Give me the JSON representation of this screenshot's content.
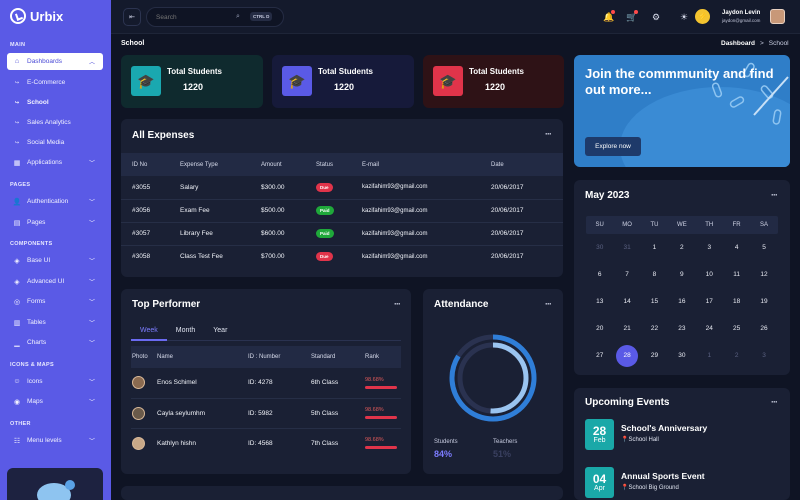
{
  "brand": "Urbix",
  "sidebar": {
    "sections": {
      "main": "MAIN",
      "pages": "PAGES",
      "components": "COMPONENTS",
      "icons": "ICONS & MAPS",
      "other": "OTHER"
    },
    "items": {
      "dashboards": "Dashboards",
      "ecommerce": "E-Commerce",
      "school": "School",
      "sales": "Sales Analytics",
      "social": "Social Media",
      "applications": "Applications",
      "authentication": "Authentication",
      "pages": "Pages",
      "base_ui": "Base UI",
      "advanced_ui": "Advanced UI",
      "forms": "Forms",
      "tables": "Tables",
      "charts": "Charts",
      "icons": "Icons",
      "maps": "Maps",
      "menu_levels": "Menu levels"
    }
  },
  "topbar": {
    "search_placeholder": "Search",
    "shortcut": "CTRL D",
    "user_name": "Jaydon Levin",
    "user_email": "jaydon@gmail.com"
  },
  "breadcrumb": {
    "title": "School",
    "home": "Dashboard",
    "separator": ">",
    "current": "School"
  },
  "stats": [
    {
      "label": "Total Students",
      "value": "1220",
      "color": "#1aa8b0",
      "bg": "#0f2a2e"
    },
    {
      "label": "Total Students",
      "value": "1220",
      "color": "#5a5ae6",
      "bg": "#161a3a"
    },
    {
      "label": "Total Students",
      "value": "1220",
      "color": "#e0344a",
      "bg": "#2e1216"
    }
  ],
  "expenses": {
    "title": "All Expenses",
    "headers": [
      "ID No",
      "Expense Type",
      "Amount",
      "Status",
      "E-mail",
      "Date"
    ],
    "rows": [
      {
        "id": "#3055",
        "type": "Salary",
        "amount": "$300.00",
        "status": "Due",
        "email": "kazifahim93@gmail.com",
        "date": "20/06/2017"
      },
      {
        "id": "#3056",
        "type": "Exam Fee",
        "amount": "$500.00",
        "status": "Paid",
        "email": "kazifahim93@gmail.com",
        "date": "20/06/2017"
      },
      {
        "id": "#3057",
        "type": "Library Fee",
        "amount": "$600.00",
        "status": "Paid",
        "email": "kazifahim93@gmail.com",
        "date": "20/06/2017"
      },
      {
        "id": "#3058",
        "type": "Class Test Fee",
        "amount": "$700.00",
        "status": "Due",
        "email": "kazifahim93@gmail.com",
        "date": "20/06/2017"
      }
    ]
  },
  "performer": {
    "title": "Top Performer",
    "tabs": [
      "Week",
      "Month",
      "Year"
    ],
    "headers": [
      "Photo",
      "Name",
      "ID : Number",
      "Standard",
      "Rank"
    ],
    "rows": [
      {
        "name": "Enos Schimel",
        "id": "ID: 4278",
        "standard": "6th Class",
        "rank": "98.68%"
      },
      {
        "name": "Cayla seylumhm",
        "id": "ID: 5982",
        "standard": "5th Class",
        "rank": "98.68%"
      },
      {
        "name": "Kathlyn hishn",
        "id": "ID: 4568",
        "standard": "7th Class",
        "rank": "98.68%"
      }
    ]
  },
  "attendance": {
    "title": "Attendance",
    "students_label": "Students",
    "students_value": "84%",
    "teachers_label": "Teachers",
    "teachers_value": "51%"
  },
  "community": {
    "title": "Join the commmunity and find out more...",
    "button": "Explore now"
  },
  "calendar": {
    "title": "May 2023",
    "days": [
      "SU",
      "MO",
      "TU",
      "WE",
      "TH",
      "FR",
      "SA"
    ],
    "weeks": [
      [
        "30",
        "31",
        "1",
        "2",
        "3",
        "4",
        "5"
      ],
      [
        "6",
        "7",
        "8",
        "9",
        "10",
        "11",
        "12"
      ],
      [
        "13",
        "14",
        "15",
        "16",
        "17",
        "18",
        "19"
      ],
      [
        "20",
        "21",
        "22",
        "23",
        "24",
        "25",
        "26"
      ],
      [
        "27",
        "28",
        "29",
        "30",
        "1",
        "2",
        "3"
      ]
    ],
    "today": "28"
  },
  "events": {
    "title": "Upcoming Events",
    "items": [
      {
        "day": "28",
        "month": "Feb",
        "title": "School's Anniversary",
        "place": "School Hall"
      },
      {
        "day": "04",
        "month": "Apr",
        "title": "Annual Sports Event",
        "place": "School Big Ground"
      }
    ]
  }
}
